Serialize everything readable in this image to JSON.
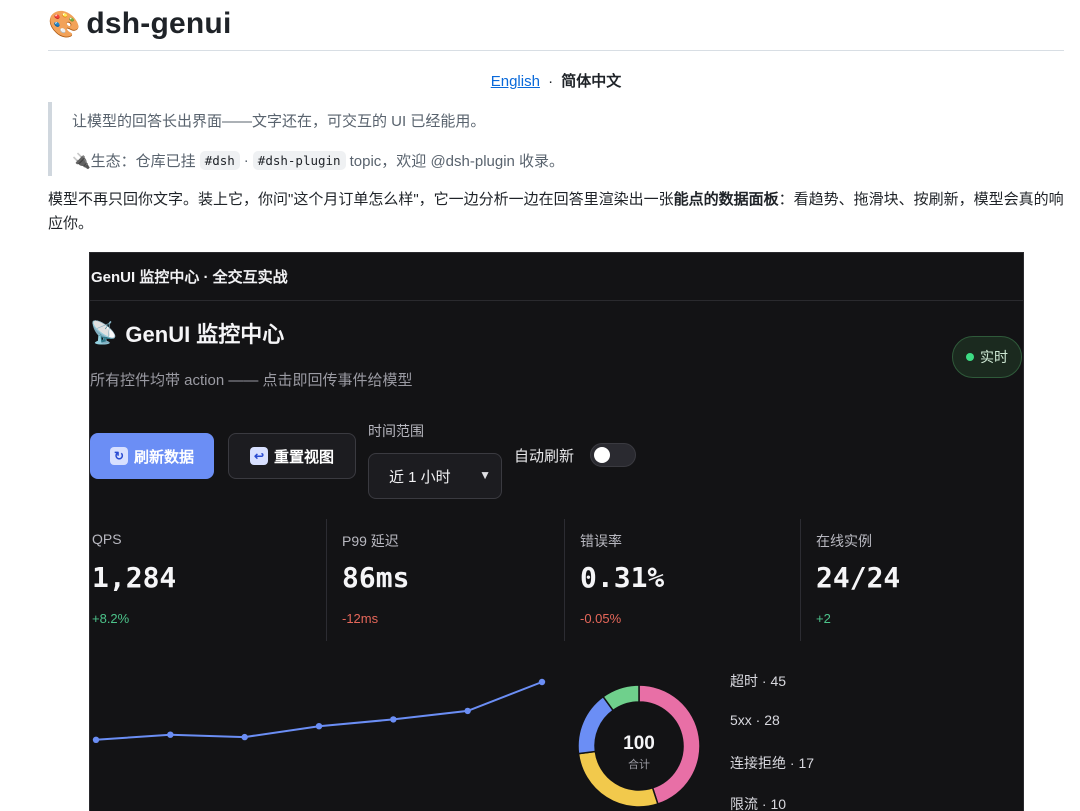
{
  "readme": {
    "title_emoji": "🎨",
    "title": "dsh-genui",
    "lang_english": "English",
    "lang_sep": "·",
    "lang_current": "简体中文",
    "quote_line1": "让模型的回答长出界面——文字还在，可交互的 UI 已经能用。",
    "quote_line2_prefix": "🔌生态：仓库已挂",
    "quote_code1": "#dsh",
    "quote_dot": "·",
    "quote_code2": "#dsh-plugin",
    "quote_line2_suffix": "topic，欢迎 @dsh-plugin 收录。",
    "para_part1": "模型不再只回你文字。装上它，你问\"这个月订单怎么样\"，它一边分析一边在回答里渲染出一张",
    "para_bold": "能点的数据面板",
    "para_part2": "：看趋势、拖滑块、按刷新，模型会真的响应你。"
  },
  "panel": {
    "header": "GenUI 监控中心 · 全交互实战",
    "dash_icon": "📡",
    "dash_title": "GenUI 监控中心",
    "dash_subtitle": "所有控件均带 action —— 点击即回传事件给模型",
    "live_label": "实时",
    "refresh_icon": "↻",
    "refresh_label": "刷新数据",
    "reset_icon": "↩",
    "reset_label": "重置视图",
    "range_label": "时间范围",
    "range_value": "近 1 小时",
    "auto_refresh_label": "自动刷新",
    "auto_refresh_on": false,
    "metrics": [
      {
        "label": "QPS",
        "value": "1,284",
        "delta": "+8.2%",
        "trend": "up"
      },
      {
        "label": "P99 延迟",
        "value": "86ms",
        "delta": "-12ms",
        "trend": "down"
      },
      {
        "label": "错误率",
        "value": "0.31%",
        "delta": "-0.05%",
        "trend": "down"
      },
      {
        "label": "在线实例",
        "value": "24/24",
        "delta": "+2",
        "trend": "up"
      }
    ],
    "colors": {
      "accent": "#6b8ef5",
      "up": "#4cc38a",
      "down": "#e5675a",
      "live": "#3ddc84"
    }
  },
  "chart_data": [
    {
      "type": "line",
      "x": [
        0,
        1,
        2,
        3,
        4,
        5,
        6
      ],
      "series": [
        {
          "values": [
            1080,
            1095,
            1088,
            1120,
            1140,
            1165,
            1250
          ]
        }
      ],
      "ylim": [
        900,
        1300
      ],
      "title": "",
      "xlabel": "",
      "ylabel": "",
      "color": "#6b8ef5"
    },
    {
      "type": "pie",
      "donut": true,
      "center_value": "100",
      "center_label": "合计",
      "categories": [
        "超时",
        "5xx",
        "连接拒绝",
        "限流"
      ],
      "values": [
        45,
        28,
        17,
        10
      ],
      "legend_labels": [
        "超时 · 45",
        "5xx · 28",
        "连接拒绝 · 17",
        "限流 · 10"
      ],
      "colors": [
        "#e86fa6",
        "#f2c94c",
        "#6b8ef5",
        "#6fd08c"
      ]
    }
  ]
}
